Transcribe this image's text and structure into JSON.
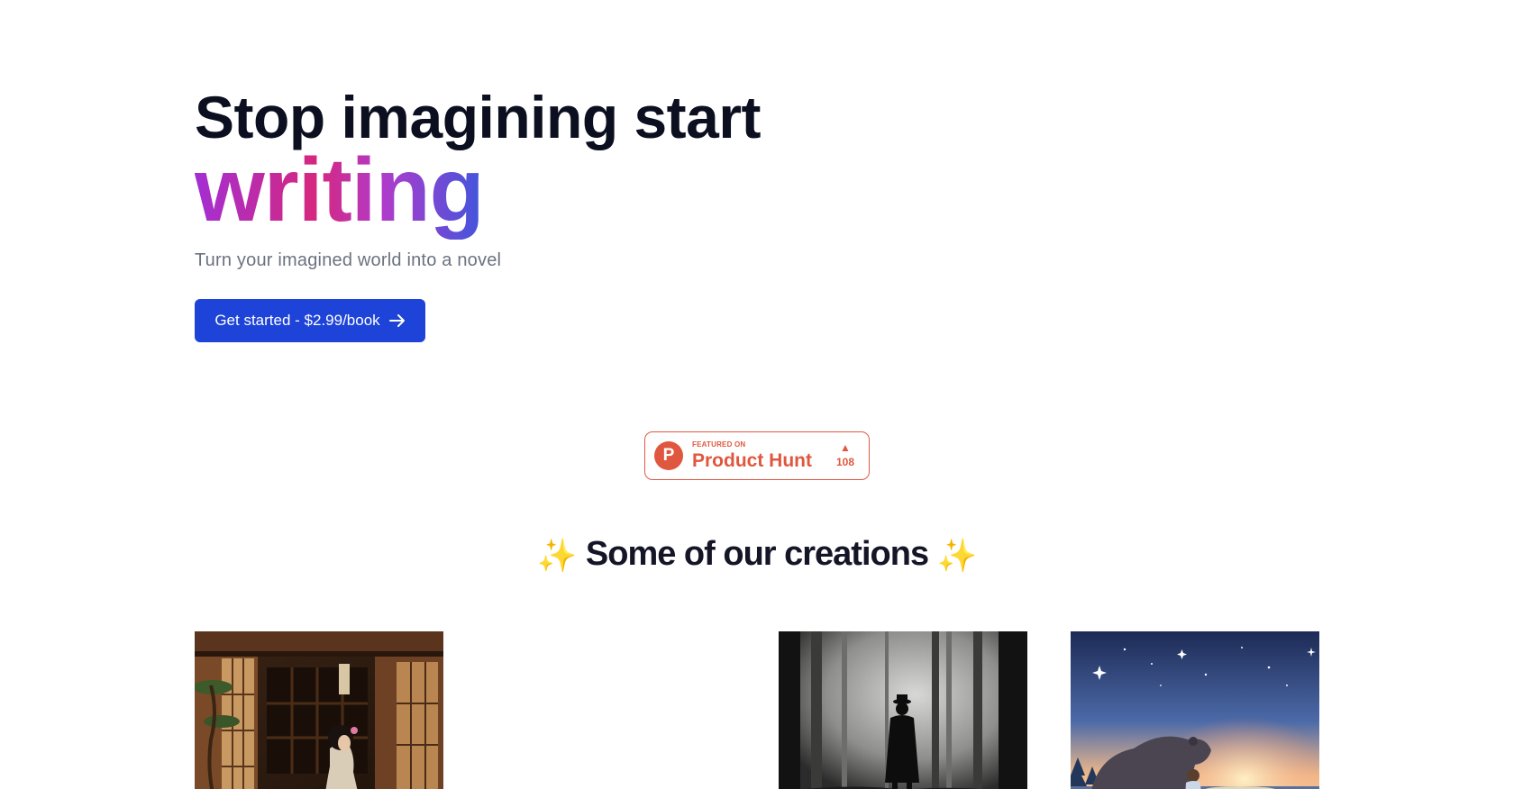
{
  "hero": {
    "title_line_1": "Stop imagining start",
    "title_line_2": "writing",
    "subtitle": "Turn your imagined world into a novel",
    "cta_label": "Get started - $2.99/book",
    "cta_icon": "arrow-right-icon"
  },
  "product_hunt": {
    "featured_label": "FEATURED ON",
    "name": "Product Hunt",
    "logo_letter": "P",
    "upvote_icon": "triangle-up-icon",
    "votes": "108",
    "color": "#e0573f"
  },
  "creations": {
    "sparkle_left": "✨",
    "title": "Some of our creations",
    "sparkle_right": "✨",
    "items": [
      {
        "icon": "japanese-woman-kimono-illustration"
      },
      {
        "icon": "man-in-foggy-forest-illustration"
      },
      {
        "icon": "bear-and-child-starry-night-illustration"
      }
    ]
  },
  "colors": {
    "cta_background": "#1d43d8",
    "heading": "#0b0f1f",
    "subtitle": "#6b7280",
    "gradient": [
      "#a32fd3",
      "#d6277e",
      "#3f56dc"
    ]
  }
}
